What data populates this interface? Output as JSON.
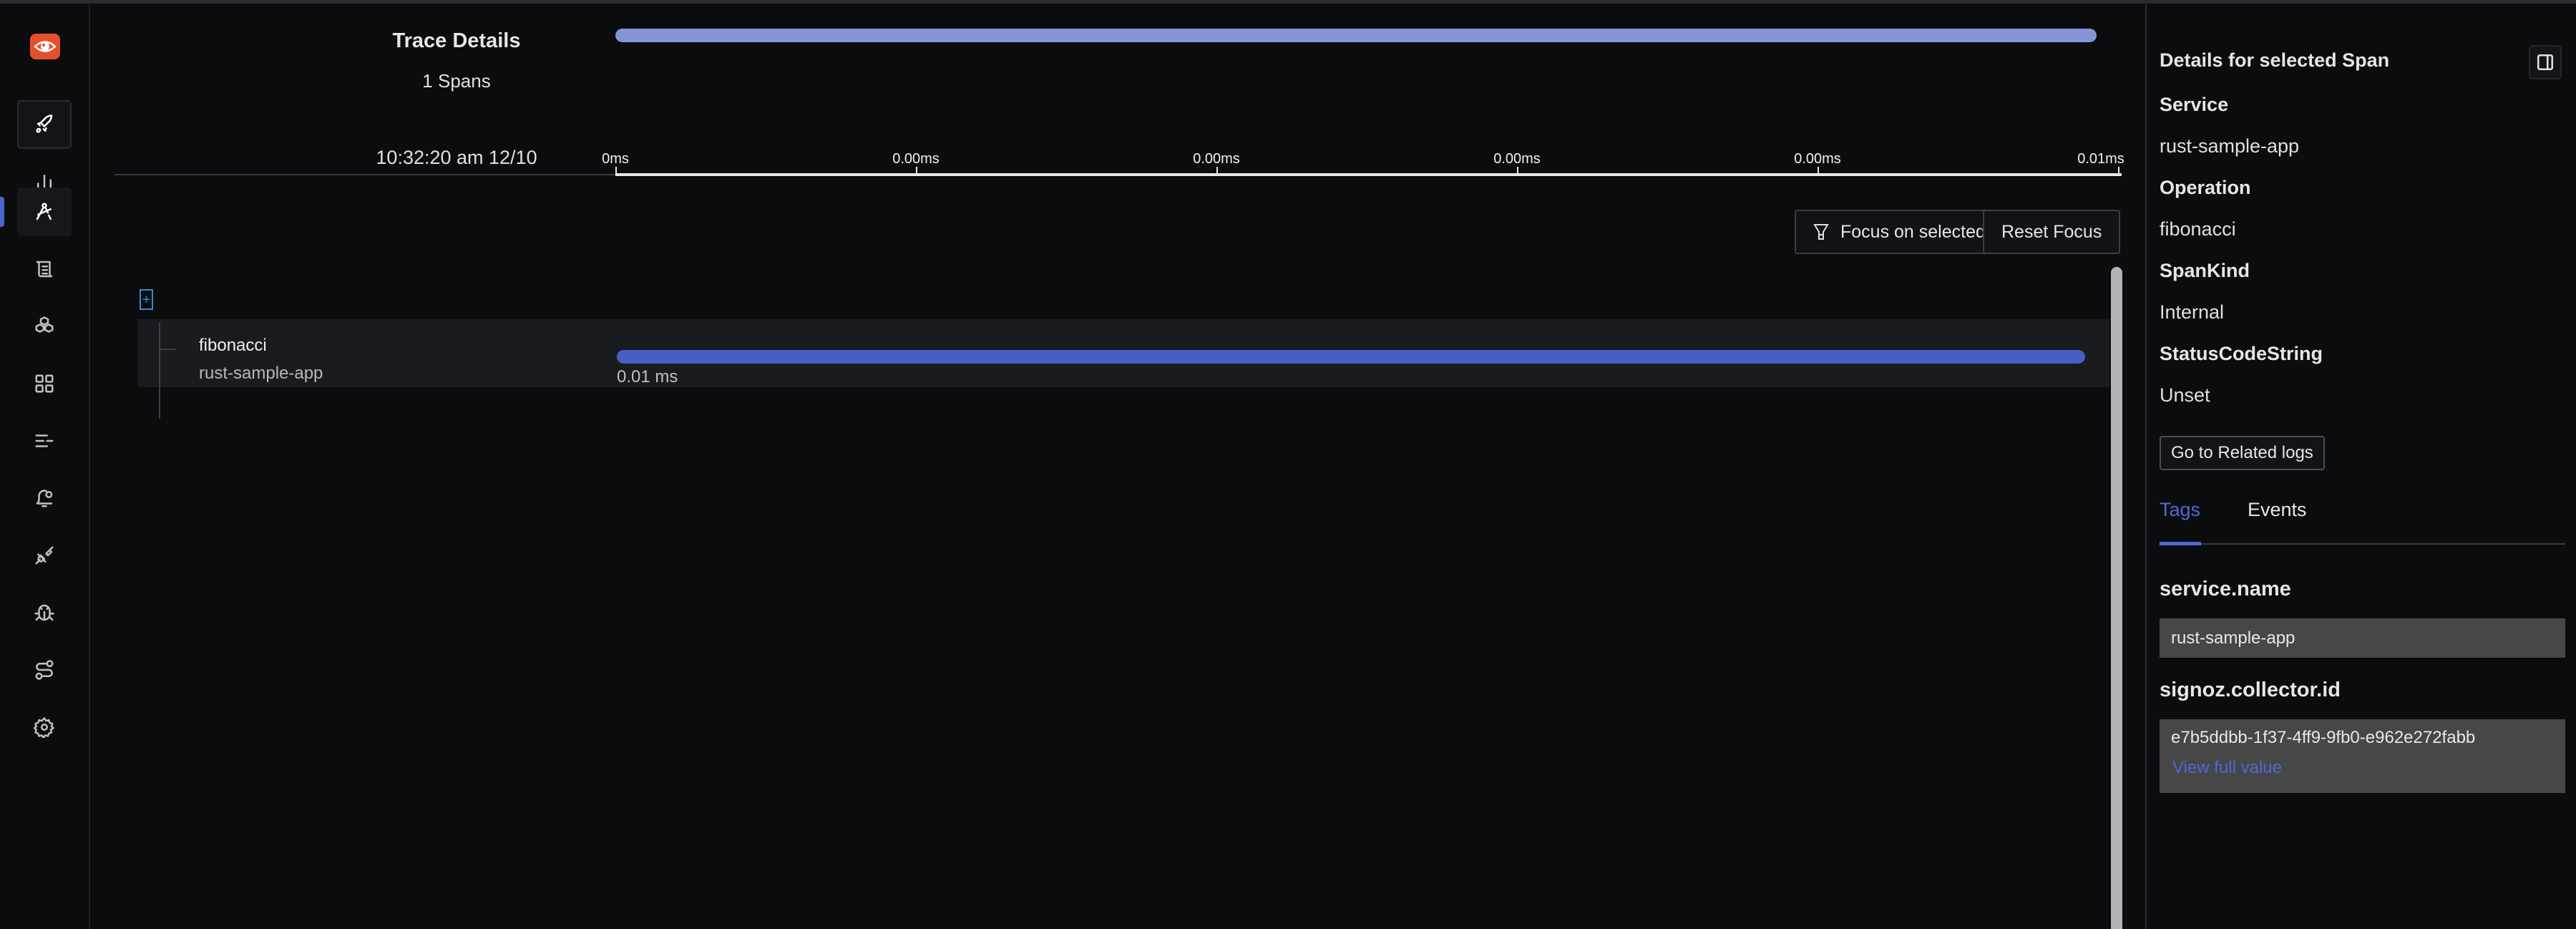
{
  "sidebar": {
    "items": [
      {
        "name": "get-started",
        "icon": "rocket-icon"
      },
      {
        "name": "dashboards-metrics",
        "icon": "bar-chart-icon"
      },
      {
        "name": "traces",
        "icon": "draw-compass-icon",
        "active": true
      },
      {
        "name": "logs",
        "icon": "scroll-icon"
      },
      {
        "name": "infrastructure",
        "icon": "boxes-icon"
      },
      {
        "name": "dashboards",
        "icon": "grid-icon"
      },
      {
        "name": "messaging-queues",
        "icon": "list-icon"
      },
      {
        "name": "alerts",
        "icon": "bell-icon"
      },
      {
        "name": "integrations",
        "icon": "plug-icon"
      },
      {
        "name": "exceptions",
        "icon": "bug-icon"
      },
      {
        "name": "pipelines",
        "icon": "route-icon"
      },
      {
        "name": "settings",
        "icon": "gear-icon"
      }
    ],
    "accent": "#4e63d0",
    "logo_color": "#e4502e"
  },
  "trace": {
    "title": "Trace Details",
    "span_count": "1 Spans",
    "start_time": "10:32:20 am 12/10"
  },
  "timeline": {
    "ticks": [
      "0ms",
      "0.00ms",
      "0.00ms",
      "0.00ms",
      "0.00ms",
      "0.01ms"
    ],
    "overview_fill": 1.0,
    "overview_color": "#8495d8"
  },
  "actions": {
    "focus_label": "Focus on selected span",
    "reset_label": "Reset Focus"
  },
  "spans": [
    {
      "operation": "fibonacci",
      "service": "rust-sample-app",
      "duration": "0.01 ms",
      "start_fraction": 0.0,
      "width_fraction": 1.0,
      "color": "#465fc4"
    }
  ],
  "details": {
    "title": "Details for selected Span",
    "fields": [
      {
        "label": "Service",
        "value": "rust-sample-app"
      },
      {
        "label": "Operation",
        "value": "fibonacci"
      },
      {
        "label": "SpanKind",
        "value": "Internal"
      },
      {
        "label": "StatusCodeString",
        "value": "Unset"
      }
    ],
    "related_logs_label": "Go to Related logs",
    "tabs": [
      {
        "label": "Tags",
        "active": true
      },
      {
        "label": "Events",
        "active": false
      }
    ],
    "tags": [
      {
        "key": "service.name",
        "value": "rust-sample-app"
      },
      {
        "key": "signoz.collector.id",
        "value": "e7b5ddbb-1f37-4ff9-9fb0-e962e272fabb",
        "link": "View full value"
      }
    ]
  }
}
